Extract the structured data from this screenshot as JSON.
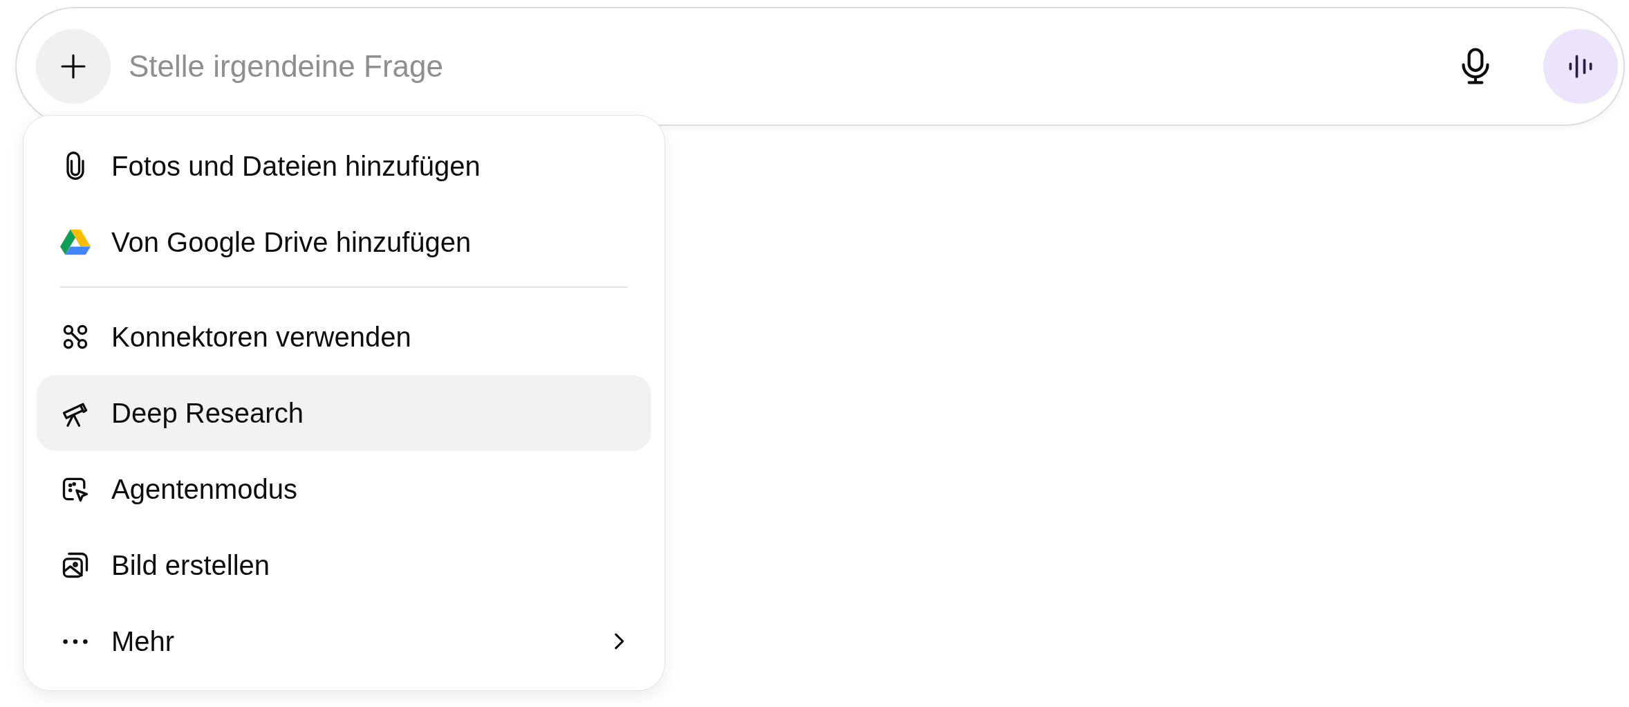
{
  "composer": {
    "placeholder": "Stelle irgendeine Frage"
  },
  "menu": {
    "groups": [
      {
        "items": [
          {
            "label": "Fotos und Dateien hinzufügen",
            "selected": false
          },
          {
            "label": "Von Google Drive hinzufügen",
            "selected": false
          }
        ]
      },
      {
        "items": [
          {
            "label": "Konnektoren verwenden",
            "selected": false
          },
          {
            "label": "Deep Research",
            "selected": true
          },
          {
            "label": "Agentenmodus",
            "selected": false
          },
          {
            "label": "Bild erstellen",
            "selected": false
          },
          {
            "label": "Mehr",
            "selected": false,
            "submenu": true
          }
        ]
      }
    ]
  }
}
